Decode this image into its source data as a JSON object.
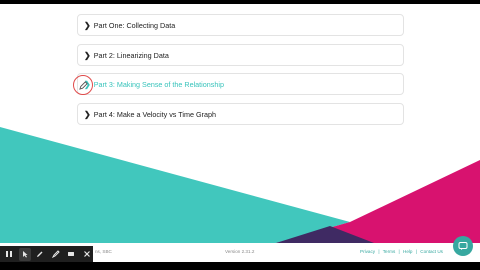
{
  "accordion": {
    "items": [
      {
        "label": "Part One: Collecting Data",
        "active": false
      },
      {
        "label": "Part 2: Linearizing Data",
        "active": false
      },
      {
        "label": "Part 3: Making Sense of the Relationship",
        "active": true
      },
      {
        "label": "Part 4: Make a Velocity vs Time Graph",
        "active": false
      }
    ],
    "chevron": "❯"
  },
  "footer": {
    "copyright_partial": "ns, SBC",
    "version": "Version 2.31.2",
    "links": [
      "Privacy",
      "|",
      "Terms",
      "|",
      "Help",
      "|",
      "Contact Us"
    ]
  },
  "toolbar": {
    "tools": [
      "pause-icon",
      "pointer-icon",
      "pen-icon",
      "highlighter-icon",
      "eraser-icon",
      "close-icon"
    ]
  },
  "colors": {
    "teal": "#37c3bb",
    "magenta": "#d8126f",
    "purple": "#3f2a63",
    "link": "#37a8a0"
  }
}
